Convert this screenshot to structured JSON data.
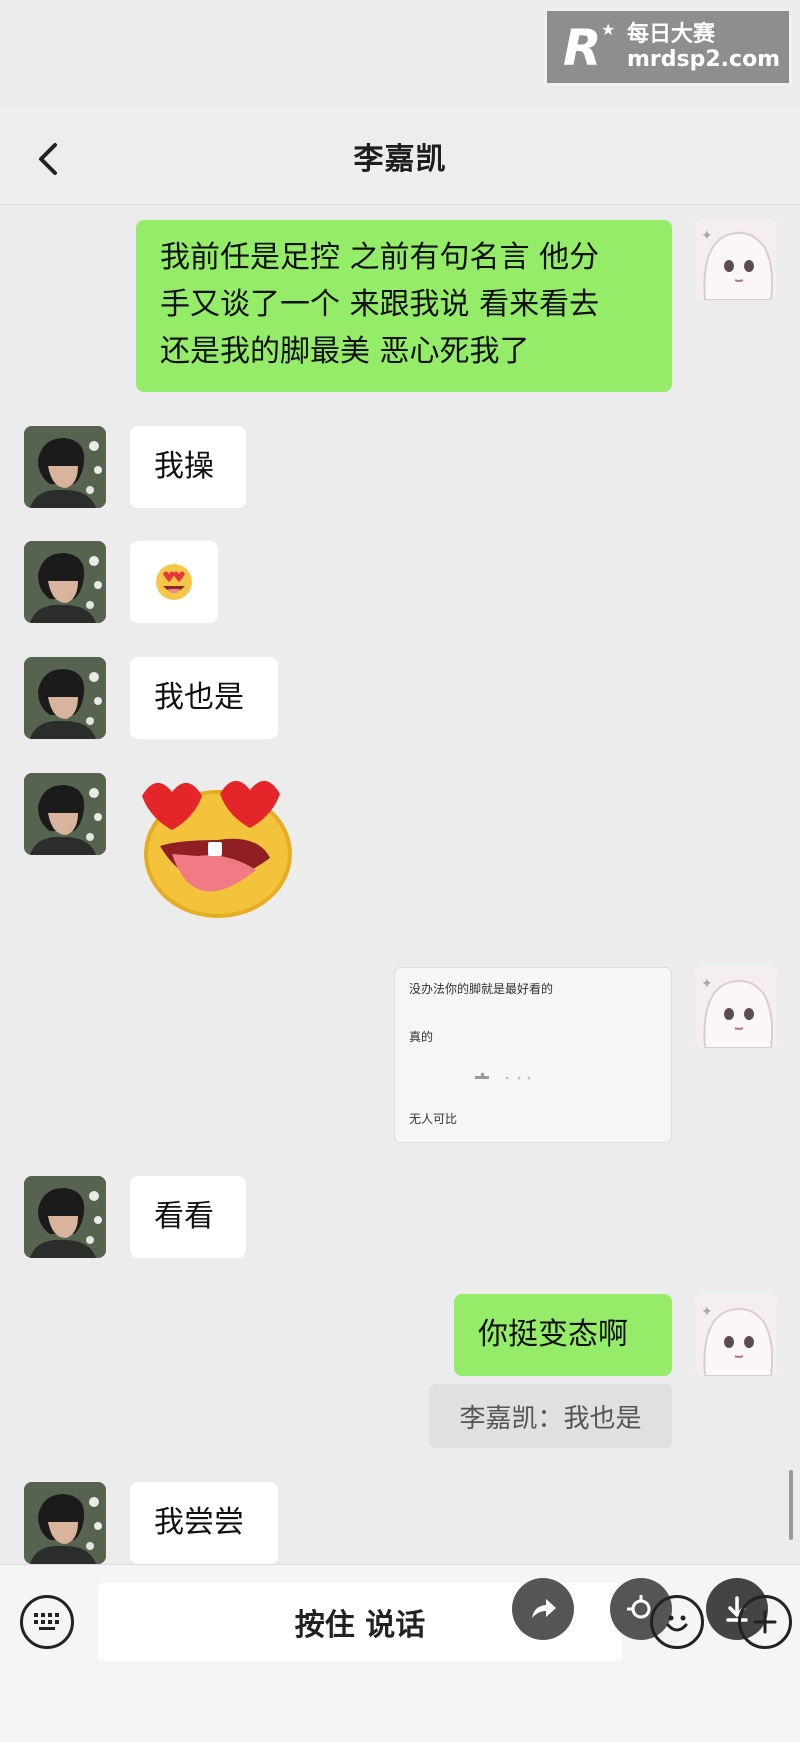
{
  "watermark": {
    "line1": "每日大赛",
    "line2": "mrdsp2.com"
  },
  "header": {
    "title": "李嘉凯"
  },
  "messages": [
    {
      "side": "right",
      "lines": [
        "我前任是足控 之前有句名言 他分",
        "手又谈了一个 来跟我说 看来看去",
        "还是我的脚最美 恶心死我了"
      ]
    },
    {
      "side": "left",
      "text": "我操"
    },
    {
      "side": "left",
      "emoji": "heart-eyes-tongue-emoji"
    },
    {
      "side": "left",
      "text": "我也是"
    },
    {
      "side": "left",
      "sticker": "heart-eyes-tongue-sticker"
    },
    {
      "side": "right",
      "screenshot": {
        "line1": "没办法你的脚就是最好看的",
        "line2": "真的",
        "line3": "无人可比"
      }
    },
    {
      "side": "left",
      "text": "看看"
    },
    {
      "side": "right",
      "text": "你挺变态啊",
      "quote": "李嘉凯：我也是"
    },
    {
      "side": "left",
      "text": "我尝尝"
    }
  ],
  "input_bar": {
    "hold_to_talk": "按住 说话"
  },
  "colors": {
    "right_bubble": "#95ec69",
    "left_bubble": "#ffffff",
    "background": "#ececec"
  }
}
